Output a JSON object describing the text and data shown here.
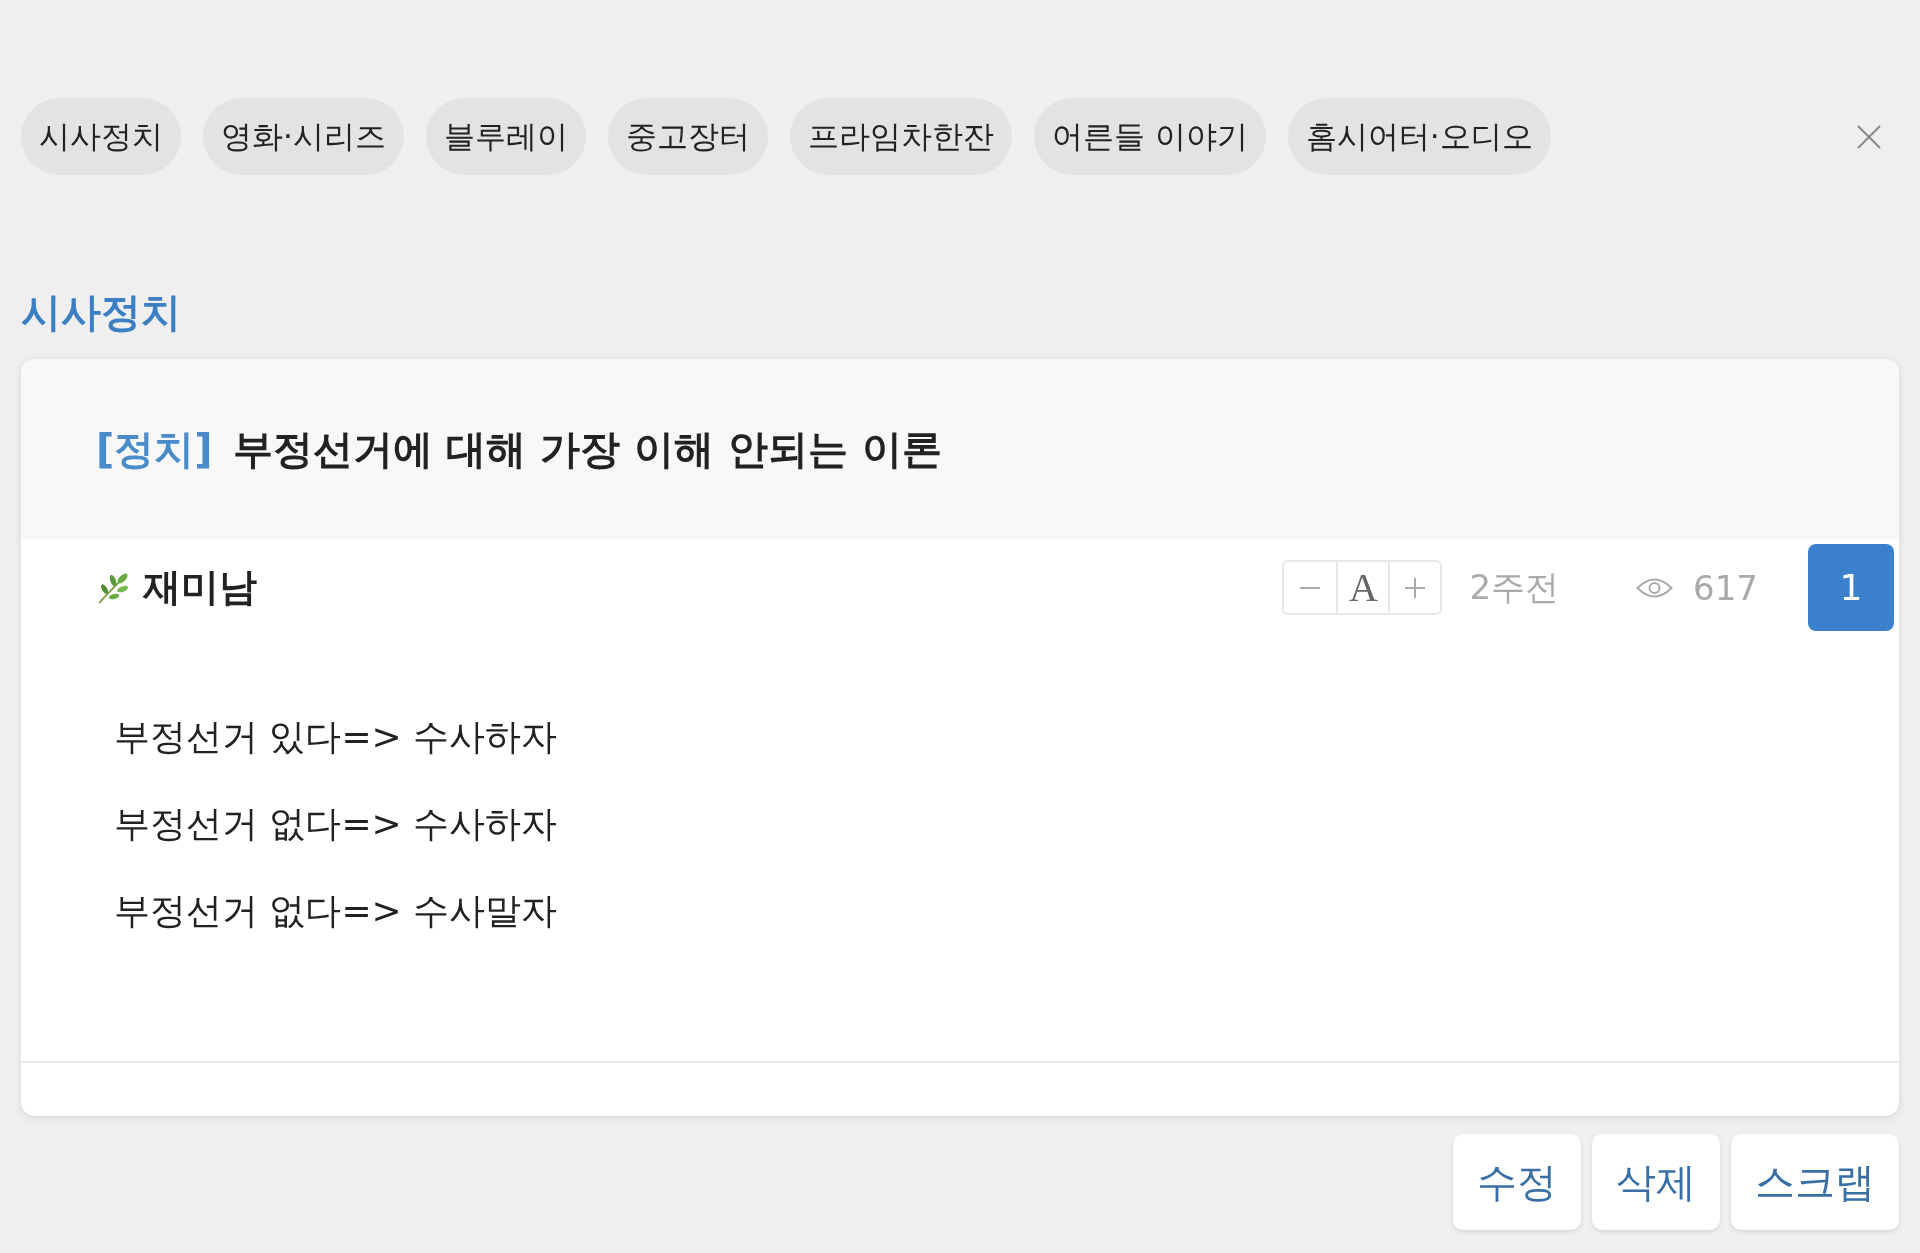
{
  "categories": [
    "시사정치",
    "영화·시리즈",
    "블루레이",
    "중고장터",
    "프라임차한잔",
    "어른들 이야기",
    "홈시어터·오디오"
  ],
  "section_title": "시사정치",
  "post": {
    "tag": "[정치]",
    "title": "부정선거에 대해 가장 이해 안되는 이론",
    "author": "재미남",
    "font_size_label": "A",
    "time": "2주전",
    "views": "617",
    "count": "1",
    "body": [
      "부정선거 있다=> 수사하자",
      "부정선거 없다=> 수사하자",
      "부정선거 없다=> 수사말자"
    ]
  },
  "actions": [
    "수정",
    "삭제",
    "스크랩"
  ]
}
